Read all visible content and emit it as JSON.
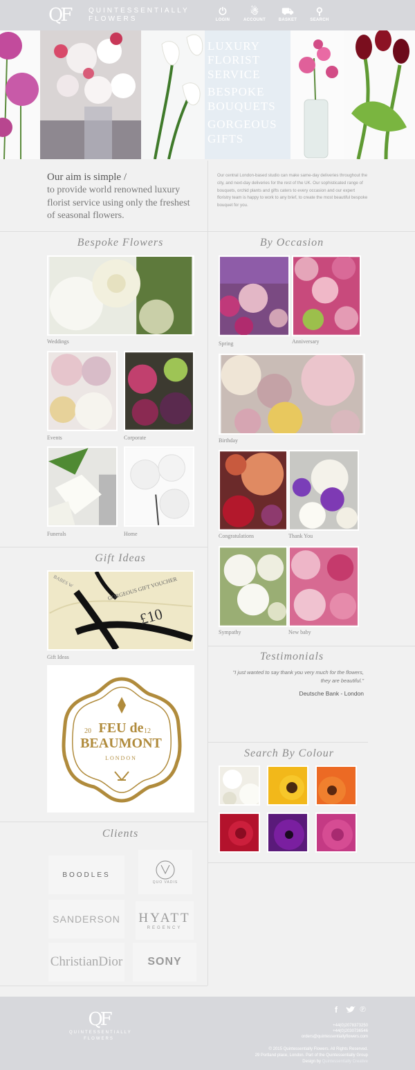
{
  "header": {
    "logo_mark": "QF",
    "logo_line1": "QUINTESSENTIALLY",
    "logo_line2": "FLOWERS",
    "nav": [
      {
        "label": "LOGIN",
        "icon": "power-icon"
      },
      {
        "label": "ACCOUNT",
        "icon": "user-icon"
      },
      {
        "label": "BASKET",
        "icon": "cart-icon"
      },
      {
        "label": "SEARCH",
        "icon": "search-icon"
      }
    ]
  },
  "hero": {
    "lines": [
      "LUXURY",
      "FLORIST",
      "SERVICE",
      "BESPOKE",
      "BOUQUETS",
      "GORGEOUS",
      "GIFTS"
    ]
  },
  "intro": {
    "title": "Our aim is simple /",
    "body": "to provide world renowned luxury florist service using only the freshest of seasonal flowers.",
    "description": "Our central London-based studio can make same-day deliveries throughout the city, and next-day deliveries for the rest of the UK. Our sophisticated range of bouquets, orchid plants and gifts caters to every occasion and our expert floristry team is happy to work to any brief, to create the most beautiful bespoke bouquet for you."
  },
  "bespoke": {
    "title": "Bespoke Flowers",
    "items": [
      "Weddings",
      "Events",
      "Corporate",
      "Funerals",
      "Home"
    ]
  },
  "occasion": {
    "title": "By Occasion",
    "items": [
      "Spring",
      "Anniversary",
      "Birthday",
      "Congratulations",
      "Thank You",
      "Sympathy",
      "New baby"
    ]
  },
  "gifts": {
    "title": "Gift Ideas",
    "caption": "Gift Ideas",
    "voucher_text": "GORGEOUS GIFT VOUCHER",
    "voucher_amount": "£10",
    "voucher_side": "BABES W",
    "seal": {
      "top": "20",
      "name1": "FEU de",
      "name2": "BEAUMONT",
      "right": "12",
      "city": "LONDON"
    }
  },
  "testimonials": {
    "title": "Testimonials",
    "quote": "\"I just wanted to say thank you very much for the flowers, they are beautiful.\"",
    "author": "Deutsche Bank - London"
  },
  "colour": {
    "title": "Search By Colour",
    "swatches": [
      "#e9e6dc",
      "#f2b81a",
      "#ec6a24",
      "#b3122c",
      "#7a1fa0",
      "#d64c93"
    ]
  },
  "clients": {
    "title": "Clients",
    "logos": [
      "BOODLES",
      "QUO VADIS",
      "SANDERSON",
      "HYATT",
      "REGENCY",
      "ChristianDior",
      "SONY"
    ]
  },
  "footer": {
    "logo_mark": "QF",
    "logo_line1": "QUINTESSENTIALLY",
    "logo_line2": "FLOWERS",
    "phone1": "+44(0)2078373250",
    "phone2": "+44(0)2030736546",
    "email": "orders@quintessentiallyflowers.com",
    "copyright": "© 2015 Quintessentially Flowers. All Rights Reserved.",
    "address": "29 Portland place, London. Part of the Quintessentially Group",
    "design_label": "Design by",
    "design_by": "Quintessentially Creative"
  }
}
